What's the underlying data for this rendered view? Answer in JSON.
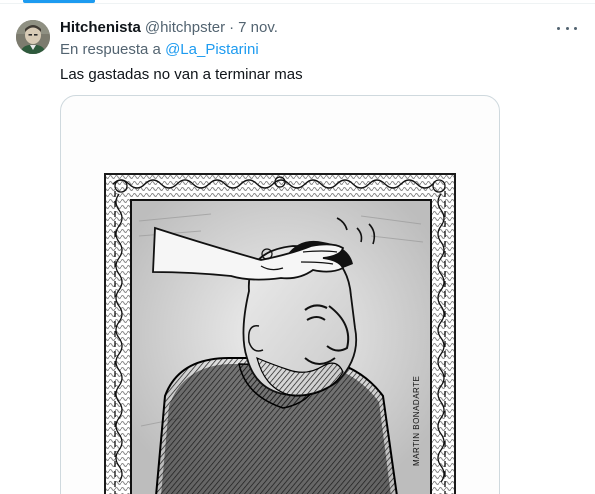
{
  "tweet": {
    "display_name": "Hitchenista",
    "handle": "@hitchpster",
    "separator": "·",
    "timestamp": "7 nov.",
    "reply_prefix": "En respuesta a",
    "reply_to": "@La_Pistarini",
    "text": "Las gastadas no van a terminar mas",
    "more_icon": "more-horizontal-icon"
  },
  "image": {
    "signature": "MARTIN BONADARTE",
    "description_icon": "cartoon-illustration"
  },
  "colors": {
    "accent": "#1d9bf0",
    "secondary_text": "#536471",
    "primary_text": "#0f1419",
    "border": "#cfd9de"
  }
}
